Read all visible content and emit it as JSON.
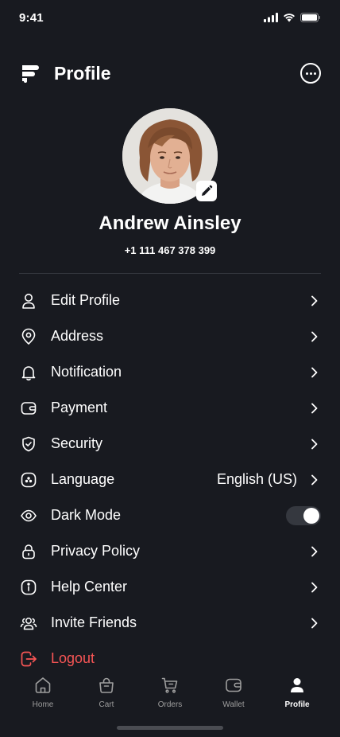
{
  "status_bar": {
    "time": "9:41"
  },
  "header": {
    "title": "Profile"
  },
  "user": {
    "name": "Andrew Ainsley",
    "phone": "+1 111 467 378 399"
  },
  "menu": {
    "items": [
      {
        "label": "Edit Profile",
        "icon": "user-icon"
      },
      {
        "label": "Address",
        "icon": "location-pin-icon"
      },
      {
        "label": "Notification",
        "icon": "bell-icon"
      },
      {
        "label": "Payment",
        "icon": "wallet-icon"
      },
      {
        "label": "Security",
        "icon": "shield-check-icon"
      },
      {
        "label": "Language",
        "icon": "more-circle-icon",
        "value": "English (US)"
      },
      {
        "label": "Dark Mode",
        "icon": "eye-icon",
        "toggle_on": true
      },
      {
        "label": "Privacy Policy",
        "icon": "lock-icon"
      },
      {
        "label": "Help Center",
        "icon": "info-circle-icon"
      },
      {
        "label": "Invite Friends",
        "icon": "users-icon"
      },
      {
        "label": "Logout",
        "icon": "logout-icon"
      }
    ]
  },
  "bottom_nav": {
    "items": [
      {
        "label": "Home",
        "icon": "home-icon"
      },
      {
        "label": "Cart",
        "icon": "bag-icon"
      },
      {
        "label": "Orders",
        "icon": "cart-icon"
      },
      {
        "label": "Wallet",
        "icon": "wallet-icon"
      },
      {
        "label": "Profile",
        "icon": "profile-icon",
        "active": true
      }
    ]
  },
  "colors": {
    "background": "#181a20",
    "text": "#ffffff",
    "danger": "#f75555",
    "divider": "#35383f",
    "nav_inactive": "#9e9e9e"
  }
}
